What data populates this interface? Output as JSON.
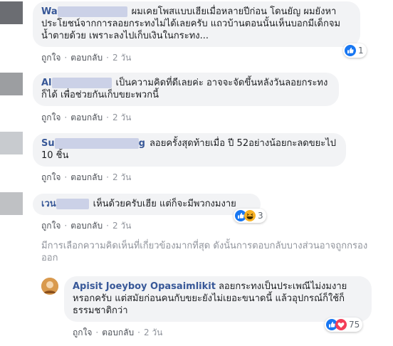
{
  "comments": [
    {
      "author": "Wa",
      "text": "ผมเคยโพสแบบเฮียเมื่อหลายปีก่อน โดนยัญ ผมยังหาประโยชน์จากการลอยกระทงไม่ได้เลยครับ แถวบ้านตอนนั้นเห็นบอกมีเด็กจมน้ำตายด้วย เพราะลงไปเก็บเงินในกระทง...",
      "like": "ถูกใจ",
      "reply": "ตอบกลับ",
      "time": "2 วัน",
      "reactions": {
        "icons": [
          "like-icon"
        ],
        "count": "1"
      }
    },
    {
      "author": "Al",
      "text": "เป็นความคิดที่ดีเลยค่ะ อาจจะจัดขึ้นหลังวันลอยกระทงก็ได้ เพื่อช่วยกันเก็บขยะพวกนี้",
      "like": "ถูกใจ",
      "reply": "ตอบกลับ",
      "time": "2 วัน"
    },
    {
      "author": "Su",
      "author_tail": "g",
      "text": "ลอยครั้งสุดท้ายเมื่อ ปี 52อย่างน้อยกะลดขยะไป 10 ชิ้น",
      "like": "ถูกใจ",
      "reply": "ตอบกลับ",
      "time": "2 วัน"
    },
    {
      "author": "เวน",
      "text": "เห็นด้วยครับเฮีย แต่ก็จะมีพวกงมงาย",
      "like": "ถูกใจ",
      "reply": "ตอบกลับ",
      "time": "2 วัน",
      "reactions": {
        "icons": [
          "like-icon",
          "haha-icon"
        ],
        "count": "3"
      }
    }
  ],
  "relevance_note": "มีการเลือกความคิดเห็นที่เกี่ยวข้องมากที่สุด ดังนั้นการตอบกลับบางส่วนอาจถูกกรองออก",
  "reply": {
    "author": "Apisit Joeyboy Opasaimlikit",
    "text": "ลอยกระทงเป็นประเพณีไม่งมงายหรอกครับ แต่สมัยก่อนคนกับขยะยังไม่เยอะขนาดนี้ แล้วอุปกรณ์ก็ใช้ก็ธรรมชาติกว่า",
    "like": "ถูกใจ",
    "reply": "ตอบกลับ",
    "time": "2 วัน",
    "reactions": {
      "icons": [
        "like-icon",
        "love-icon"
      ],
      "count": "75"
    }
  },
  "separator": "·",
  "colors": {
    "author": "#385898",
    "bubble": "#f2f3f5",
    "meta": "#90949c",
    "like": "#1877f2",
    "love": "#f33e58",
    "haha": "#f7b125"
  }
}
